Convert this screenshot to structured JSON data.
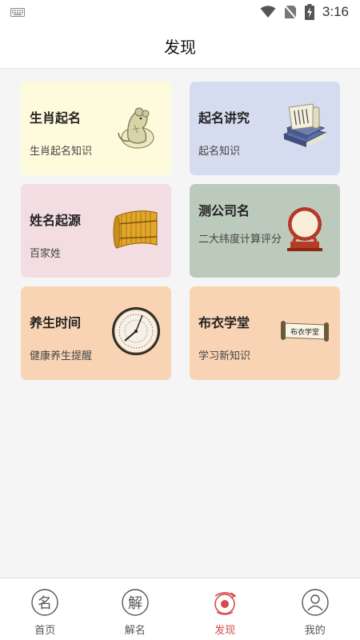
{
  "status_bar": {
    "time": "3:16"
  },
  "header": {
    "title": "发现"
  },
  "cards": [
    {
      "title": "生肖起名",
      "subtitle": "生肖起名知识",
      "icon": "rat-zodiac-icon"
    },
    {
      "title": "起名讲究",
      "subtitle": "起名知识",
      "icon": "books-scroll-icon"
    },
    {
      "title": "姓名起源",
      "subtitle": "百家姓",
      "icon": "bamboo-scroll-icon"
    },
    {
      "title": "测公司名",
      "subtitle": "二大纬度计算评分",
      "icon": "drum-icon"
    },
    {
      "title": "养生时间",
      "subtitle": "健康养生提醒",
      "icon": "clock-icon"
    },
    {
      "title": "布衣学堂",
      "subtitle": "学习新知识",
      "icon": "calligraphy-scroll-icon",
      "scroll_text": "布衣学堂"
    }
  ],
  "nav": [
    {
      "label": "首页",
      "icon": "home-icon",
      "glyph": "名"
    },
    {
      "label": "解名",
      "icon": "interpret-icon",
      "glyph": "解"
    },
    {
      "label": "发现",
      "icon": "discover-icon",
      "active": true
    },
    {
      "label": "我的",
      "icon": "profile-icon"
    }
  ],
  "colors": {
    "accent": "#d64b4b",
    "card_yellow": "#fefbdc",
    "card_blue": "#d6dcf0",
    "card_pink": "#f3dde2",
    "card_green": "#bccabb",
    "card_orange": "#f9d4b4"
  }
}
